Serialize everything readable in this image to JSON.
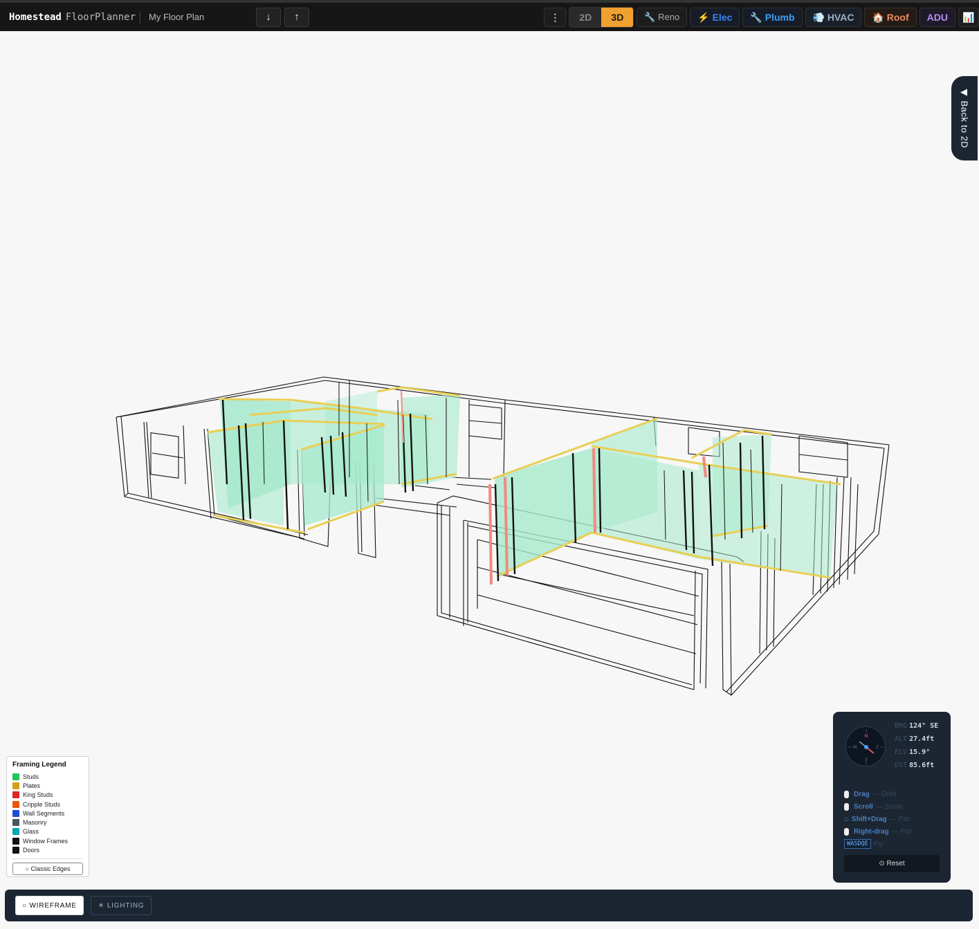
{
  "app": {
    "brand": "Homestead",
    "brand_sub": "FloorPlanner",
    "plan_name": "My Floor Plan"
  },
  "toolbar": {
    "more_label": "⋮",
    "view_2d": "2D",
    "view_3d": "3D",
    "reno": "🔧 Reno",
    "elec": "⚡ Elec",
    "plumb": "🔧 Plumb",
    "hvac": "💨 HVAC",
    "roof": "🏠 Roof",
    "adu": "ADU",
    "stats_icon": "📊"
  },
  "back_to_2d": "◀ Back to 2D",
  "legend": {
    "title": "Framing Legend",
    "items": [
      {
        "label": "Studs",
        "color": "#22c55e"
      },
      {
        "label": "Plates",
        "color": "#d4a017"
      },
      {
        "label": "King Studs",
        "color": "#dc2626"
      },
      {
        "label": "Cripple Studs",
        "color": "#ea580c"
      },
      {
        "label": "Wall Segments",
        "color": "#1d4ed8"
      },
      {
        "label": "Masonry",
        "color": "#4b5563"
      },
      {
        "label": "Glass",
        "color": "#06a6b4"
      },
      {
        "label": "Window Frames",
        "color": "#111111"
      },
      {
        "label": "Doors",
        "color": "#111111"
      }
    ],
    "classic_edges": "○ Classic Edges"
  },
  "nav": {
    "brg_label": "BRG",
    "brg": "124° SE",
    "alt_label": "ALT",
    "alt": "27.4ft",
    "elv_label": "ELV",
    "elv": "15.9°",
    "dst_label": "DST",
    "dst": "85.6ft",
    "compass": {
      "n": "N",
      "s": "S",
      "e": "E",
      "w": "W"
    },
    "hints": [
      {
        "key": "Drag",
        "desc": "— Orbit"
      },
      {
        "key": "Scroll",
        "desc": "— Zoom"
      },
      {
        "key": "Shift+Drag",
        "desc": "— Pan"
      },
      {
        "key": "Right-drag",
        "desc": "— Pan"
      }
    ],
    "fly_key": "WASDQE",
    "fly_desc": "Fly",
    "reset": "⊙ Reset"
  },
  "bottom": {
    "wireframe": "○ WIREFRAME",
    "lighting": "☀ LIGHTING"
  },
  "colors": {
    "stud_fill": "#a6e9cc",
    "plate": "#e8cf55",
    "king": "#f08a80",
    "accent": "#f0a030"
  }
}
